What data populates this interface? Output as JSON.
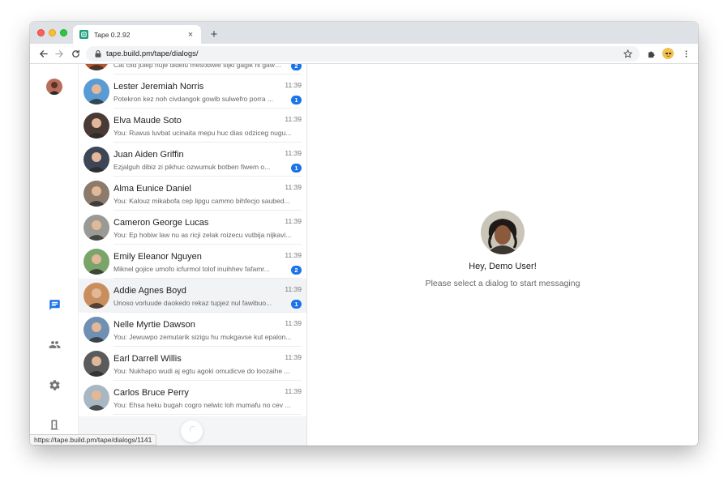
{
  "browser": {
    "tab_title": "Tape 0.2.92",
    "tab_close": "×",
    "new_tab": "+",
    "url": "tape.build.pm/tape/dialogs/",
    "status_url": "https://tape.build.pm/tape/dialogs/1141"
  },
  "rail": {
    "items": [
      {
        "icon": "chat-icon",
        "active": true
      },
      {
        "icon": "people-icon",
        "active": false
      },
      {
        "icon": "settings-icon",
        "active": false
      },
      {
        "icon": "logout-icon",
        "active": false
      }
    ]
  },
  "dialogs": [
    {
      "name": "",
      "time": "",
      "preview": "Cat ciid julep nuje didelu mesobiwe sijki gagik hi gawa...",
      "badge": "2",
      "avatar_color": "#b5562f"
    },
    {
      "name": "Lester Jeremiah Norris",
      "time": "11:39",
      "preview": "Potekron kez noh civdangok gowib sulwefro porra ...",
      "badge": "1",
      "avatar_color": "#5a9bd4"
    },
    {
      "name": "Elva Maude Soto",
      "time": "11:39",
      "preview": "You: Ruwus luvbat ucinaita mepu huc dias odziceg nugu...",
      "badge": "",
      "avatar_color": "#4a3a35"
    },
    {
      "name": "Juan Aiden Griffin",
      "time": "11:39",
      "preview": "Ezjalguh dibiz zi pikhuc ozwumuk botben fiwem o...",
      "badge": "1",
      "avatar_color": "#3c4656"
    },
    {
      "name": "Alma Eunice Daniel",
      "time": "11:39",
      "preview": "You: Kalouz mikabofa cep lipgu cammo bihfecjo saubed...",
      "badge": "",
      "avatar_color": "#8c7a6b"
    },
    {
      "name": "Cameron George Lucas",
      "time": "11:39",
      "preview": "You: Ep hobiw law nu as ricji zelak roizecu vutbija nijkavi...",
      "badge": "",
      "avatar_color": "#9a9a95"
    },
    {
      "name": "Emily Eleanor Nguyen",
      "time": "11:39",
      "preview": "Miknel gojice umofo icfurmol tolof inuihhev fafamr...",
      "badge": "2",
      "avatar_color": "#7aa46a"
    },
    {
      "name": "Addie Agnes Boyd",
      "time": "11:39",
      "preview": "Unoso vorluude daokedo rekaz tupjez nul fawibuo...",
      "badge": "1",
      "avatar_color": "#c98e5e"
    },
    {
      "name": "Nelle Myrtie Dawson",
      "time": "11:39",
      "preview": "You: Jewuwpo zemutarik sizigu hu mukgavse kut epalon...",
      "badge": "",
      "avatar_color": "#6f8fb3"
    },
    {
      "name": "Earl Darrell Willis",
      "time": "11:39",
      "preview": "You: Nukhapo wudi aj egtu agoki omudicve do loozaihe ...",
      "badge": "",
      "avatar_color": "#5b5b5b"
    },
    {
      "name": "Carlos Bruce Perry",
      "time": "11:39",
      "preview": "You: Ehsa heku bugah cogro nelwic loh mumafu no cev ...",
      "badge": "",
      "avatar_color": "#a9b7c2"
    }
  ],
  "welcome": {
    "greeting": "Hey, Demo User!",
    "hint": "Please select a dialog to start messaging"
  },
  "colors": {
    "accent": "#1a73e8",
    "rail_icon": "#757575"
  }
}
